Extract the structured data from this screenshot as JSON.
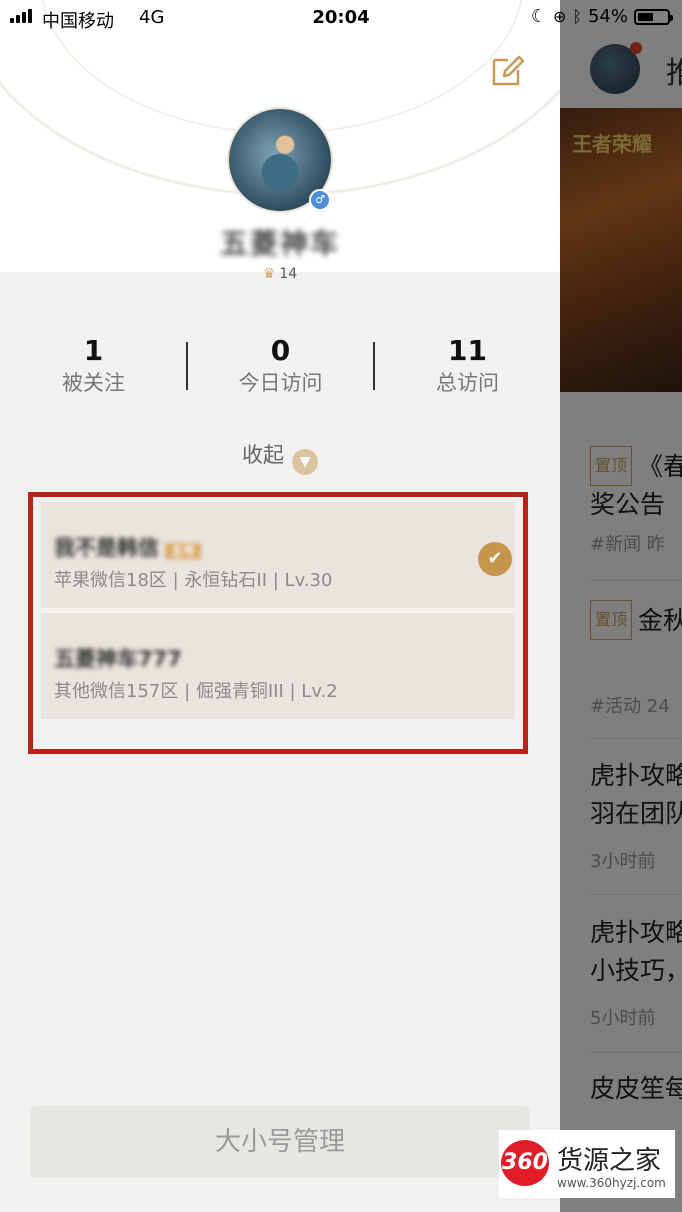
{
  "status_bar": {
    "carrier": "中国移动",
    "network": "4G",
    "time": "20:04",
    "battery": "54%",
    "battery_level": 0.54
  },
  "profile": {
    "username": "五菱神车",
    "vip_level": "14",
    "gender_symbol": "♂"
  },
  "stats": [
    {
      "value": "1",
      "label": "被关注"
    },
    {
      "value": "0",
      "label": "今日访问"
    },
    {
      "value": "11",
      "label": "总访问"
    }
  ],
  "collapse_label": "收起",
  "accounts": [
    {
      "name": "我不是韩信",
      "tag": "主号",
      "info": "苹果微信18区 | 永恒钻石II | Lv.30",
      "selected": true
    },
    {
      "name": "五菱神车777",
      "tag": "",
      "info": "其他微信157区 | 倔强青铜III | Lv.2",
      "selected": false
    }
  ],
  "manage_button": "大小号管理",
  "background_app": {
    "tab": "推",
    "logo": "王者荣耀",
    "items": [
      {
        "tag": "置顶",
        "title": "《春",
        "title2": "奖公告",
        "meta": "#新闻  昨"
      },
      {
        "tag": "置顶",
        "title": "金秋",
        "title2": "",
        "meta": "#活动  24"
      },
      {
        "tag": "",
        "title": "虎扑攻略",
        "title2": "羽在团队",
        "meta": "3小时前"
      },
      {
        "tag": "",
        "title": "虎扑攻略",
        "title2": "小技巧，",
        "meta": "5小时前"
      },
      {
        "tag": "",
        "title": "皮皮笙每",
        "title2": "",
        "meta": ""
      }
    ]
  },
  "watermark": {
    "badge": "360",
    "name": "货源之家",
    "url": "www.360hyzj.com"
  }
}
